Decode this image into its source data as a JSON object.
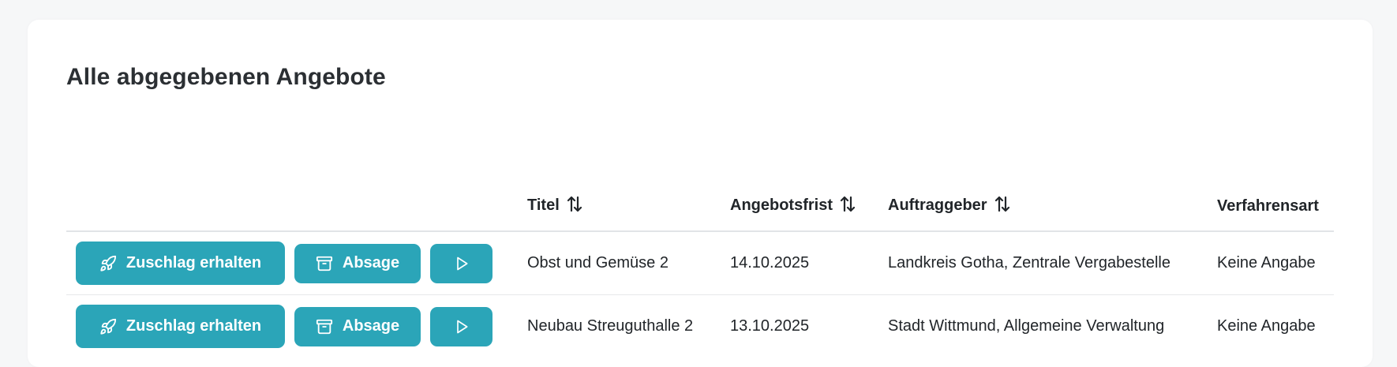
{
  "card": {
    "title": "Alle abgegebenen Angebote"
  },
  "table": {
    "columns": [
      {
        "key": "actions",
        "label": "",
        "sortable": false
      },
      {
        "key": "titel",
        "label": "Titel",
        "sortable": true
      },
      {
        "key": "angebotsfrist",
        "label": "Angebotsfrist",
        "sortable": true
      },
      {
        "key": "auftraggeber",
        "label": "Auftraggeber",
        "sortable": true
      },
      {
        "key": "verfahrensart",
        "label": "Verfahrensart",
        "sortable": false
      }
    ],
    "rows": [
      {
        "titel": "Obst und Gemüse 2",
        "angebotsfrist": "14.10.2025",
        "auftraggeber": "Landkreis Gotha, Zentrale Vergabestelle",
        "verfahrensart": "Keine Angabe"
      },
      {
        "titel": "Neubau Streuguthalle 2",
        "angebotsfrist": "13.10.2025",
        "auftraggeber": "Stadt Wittmund, Allgemeine Verwaltung",
        "verfahrensart": "Keine Angabe"
      }
    ]
  },
  "actions": {
    "zuschlag_label": "Zuschlag erhalten",
    "zuschlag_icon": "rocket-icon",
    "absage_label": "Absage",
    "absage_icon": "archive-icon",
    "play_icon": "play-icon"
  },
  "colors": {
    "accent": "#2ba5b8",
    "background": "#f6f7f8",
    "card": "#ffffff",
    "text": "#212529"
  }
}
